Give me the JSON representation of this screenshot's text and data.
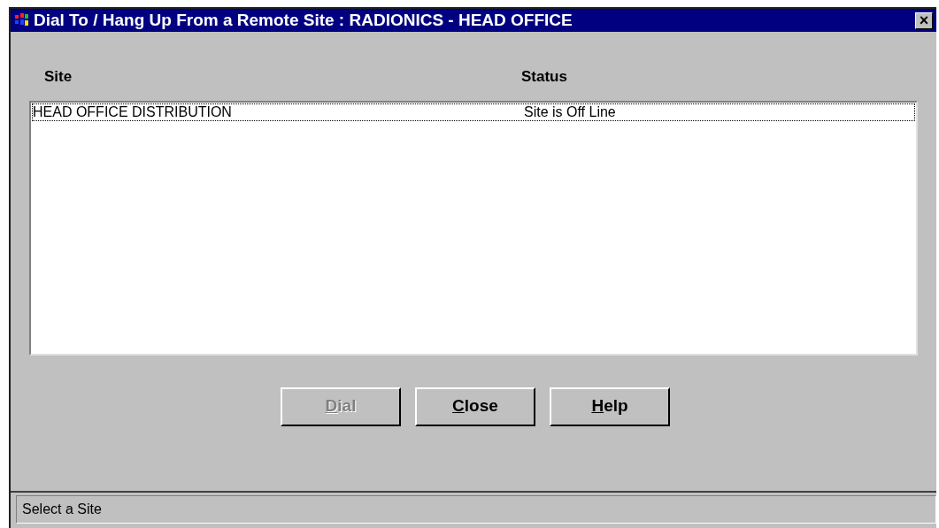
{
  "window": {
    "title": "Dial To / Hang Up From a Remote Site : RADIONICS - HEAD OFFICE",
    "close": "×"
  },
  "table": {
    "columns": [
      "Site",
      "Status"
    ],
    "rows": [
      {
        "site": "HEAD OFFICE DISTRIBUTION",
        "status": "Site is Off Line",
        "focused": true
      }
    ]
  },
  "buttons": [
    {
      "label": "Dial",
      "first_letter_underlined": true,
      "disabled": true
    },
    {
      "label": "Close",
      "first_letter_underlined": true,
      "disabled": false
    },
    {
      "label": "Help",
      "first_letter_underlined": true,
      "disabled": false
    }
  ],
  "status_bar": "Select a Site"
}
